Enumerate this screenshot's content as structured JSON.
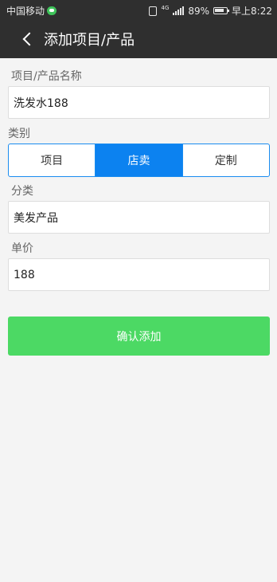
{
  "status_bar": {
    "carrier": "中国移动",
    "network": "4G",
    "battery": "89%",
    "time": "早上8:22"
  },
  "nav": {
    "title": "添加项目/产品"
  },
  "form": {
    "name_label": "项目/产品名称",
    "name_value": "洗发水188",
    "category_label": "类别",
    "category_options": [
      "项目",
      "店卖",
      "定制"
    ],
    "category_selected": "店卖",
    "classification_label": "分类",
    "classification_value": "美发产品",
    "price_label": "单价",
    "price_value": "188",
    "submit_label": "确认添加"
  },
  "colors": {
    "header_bg": "#2f2f2f",
    "accent_blue": "#0c82f0",
    "confirm_green": "#4cd964",
    "page_bg": "#f4f4f4"
  }
}
